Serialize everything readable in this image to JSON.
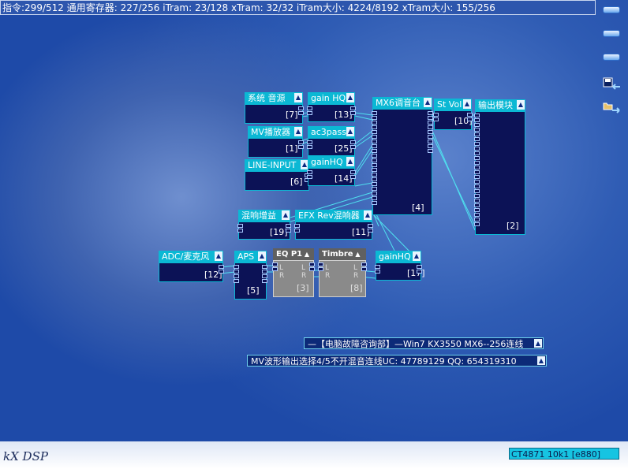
{
  "status_bar": {
    "text": "指令:299/512 通用寄存器: 227/256 iTram: 23/128 xTram: 32/32 iTram大小: 4224/8192 xTram大小: 155/256"
  },
  "sidebar": {
    "buttons": [
      "menu-1",
      "menu-2",
      "menu-3"
    ],
    "icons": [
      "save-icon",
      "open-icon"
    ]
  },
  "modules": [
    {
      "id": "sys-source",
      "title": "系统  音源",
      "index": "[7]"
    },
    {
      "id": "mv-player",
      "title": "MV播放器",
      "index": "[1]"
    },
    {
      "id": "line-input",
      "title": "LINE-INPUT",
      "index": "[6]"
    },
    {
      "id": "gain-hq-13",
      "title": "gain HQ",
      "index": "[13]"
    },
    {
      "id": "ac3pass",
      "title": "ac3pass",
      "index": "[25]"
    },
    {
      "id": "gainhq-14",
      "title": "gainHQ",
      "index": "[14]"
    },
    {
      "id": "mx6-mixer",
      "title": "MX6调音台",
      "index": "[4]"
    },
    {
      "id": "st-vol",
      "title": "St Vol",
      "index": "[10]"
    },
    {
      "id": "output-module",
      "title": "输出模块",
      "index": "[2]"
    },
    {
      "id": "reverb-gain",
      "title": "混响增益",
      "index": "[19]"
    },
    {
      "id": "efx-rev",
      "title": "EFX Rev混响器",
      "index": "[11]"
    },
    {
      "id": "adc-mic",
      "title": "ADC/麦克风",
      "index": "[12]"
    },
    {
      "id": "aps",
      "title": "APS",
      "index": "[5]"
    },
    {
      "id": "eq-p1",
      "title": "EQ P1",
      "index": "[3]",
      "gray": true
    },
    {
      "id": "timbre",
      "title": "Timbre",
      "index": "[8]",
      "gray": true
    },
    {
      "id": "gainhq-17",
      "title": "gainHQ",
      "index": "[17]"
    }
  ],
  "port_labels": {
    "left": "L",
    "right": "R"
  },
  "info_bars": [
    "—【电脑故障咨询部】—Win7 KX3550 MX6--256连线",
    "MV波形输出选择4/5不开混音连线UC: 47789129 QQ: 654319310"
  ],
  "logo": "kX DSP",
  "chip_info": "CT4871 10k1 [e880]",
  "colors": {
    "header": "#0bb8d4",
    "body": "#0c1256",
    "background": "#2451ad",
    "wire": "#4fe0ef"
  }
}
